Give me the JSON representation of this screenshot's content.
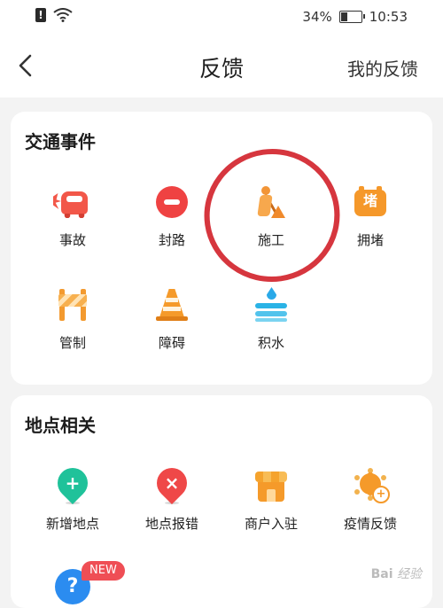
{
  "status_bar": {
    "battery": "34%",
    "time": "10:53",
    "battery_level": 0.34
  },
  "header": {
    "title": "反馈",
    "right_action": "我的反馈"
  },
  "traffic": {
    "title": "交通事件",
    "items": [
      {
        "label": "事故",
        "icon": "car-accident-icon"
      },
      {
        "label": "封路",
        "icon": "road-closed-icon"
      },
      {
        "label": "施工",
        "icon": "construction-icon"
      },
      {
        "label": "拥堵",
        "icon": "traffic-jam-icon",
        "icon_char": "堵"
      },
      {
        "label": "管制",
        "icon": "traffic-control-icon"
      },
      {
        "label": "障碍",
        "icon": "traffic-cone-icon"
      },
      {
        "label": "积水",
        "icon": "water-icon"
      }
    ]
  },
  "places": {
    "title": "地点相关",
    "items": [
      {
        "label": "新增地点",
        "icon": "add-location-icon"
      },
      {
        "label": "地点报错",
        "icon": "location-error-icon"
      },
      {
        "label": "商户入驻",
        "icon": "shop-icon"
      },
      {
        "label": "疫情反馈",
        "icon": "virus-icon"
      }
    ]
  },
  "extra": {
    "badge": "NEW",
    "icon": "help-icon"
  },
  "watermark": {
    "text": "Bai",
    "suffix": "经验"
  },
  "colors": {
    "annotation": "#d6363e",
    "accent_orange": "#f59a2a",
    "accent_red": "#ef4242"
  }
}
